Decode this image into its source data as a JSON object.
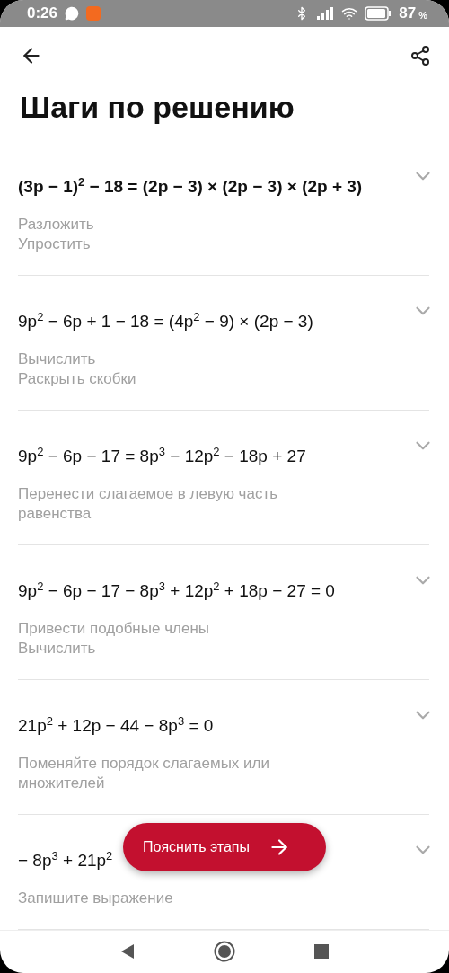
{
  "status_bar": {
    "time": "0:26",
    "battery": "87",
    "battery_unit": "%"
  },
  "header": {
    "title": "Шаги по решению"
  },
  "steps": [
    {
      "formula": "(3p − 1)$^{2}$ − 18 = (2p − 3) × (2p − 3) × (2p + 3)",
      "bold": true,
      "expanded": false,
      "descriptions": [
        "Разложить",
        "Упростить"
      ]
    },
    {
      "formula": "9p$^{2}$ − 6p + 1 − 18 = (4p$^{2}$ − 9) × (2p − 3)",
      "bold": false,
      "expanded": false,
      "descriptions": [
        "Вычислить",
        "Раскрыть скобки"
      ]
    },
    {
      "formula": "9p$^{2}$ − 6p − 17 = 8p$^{3}$ − 12p$^{2}$ − 18p + 27",
      "bold": false,
      "expanded": false,
      "descriptions": [
        "Перенести слагаемое в левую часть равенства"
      ]
    },
    {
      "formula": "9p$^{2}$ − 6p − 17 − 8p$^{3}$ + 12p$^{2}$ + 18p − 27 = 0",
      "bold": false,
      "expanded": false,
      "descriptions": [
        "Привести подобные члены",
        "Вычислить"
      ]
    },
    {
      "formula": "21p$^{2}$ + 12p − 44 − 8p$^{3}$ = 0",
      "bold": false,
      "expanded": false,
      "descriptions": [
        "Поменяйте порядок слагаемых или множителей"
      ]
    },
    {
      "formula": "− 8p$^{3}$ + 21p$^{2}$",
      "bold": false,
      "expanded": false,
      "descriptions": [
        "Запишите выражение"
      ]
    }
  ],
  "explain_button": {
    "label": "Пояснить этапы"
  }
}
